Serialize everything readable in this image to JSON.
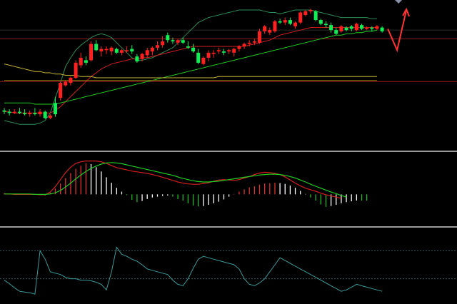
{
  "chart_data": [
    {
      "type": "candlestick",
      "panel": "price",
      "ylim": [
        0,
        100
      ],
      "candles": [
        {
          "o": 20,
          "h": 22,
          "l": 17,
          "c": 19
        },
        {
          "o": 19,
          "h": 21,
          "l": 16,
          "c": 18
        },
        {
          "o": 18,
          "h": 21,
          "l": 17,
          "c": 19
        },
        {
          "o": 19,
          "h": 22,
          "l": 17,
          "c": 18
        },
        {
          "o": 18,
          "h": 21,
          "l": 16,
          "c": 17
        },
        {
          "o": 17,
          "h": 20,
          "l": 15,
          "c": 18
        },
        {
          "o": 18,
          "h": 22,
          "l": 16,
          "c": 17
        },
        {
          "o": 17,
          "h": 21,
          "l": 15,
          "c": 19
        },
        {
          "o": 19,
          "h": 20,
          "l": 13,
          "c": 14
        },
        {
          "o": 14,
          "h": 17,
          "l": 13,
          "c": 16
        },
        {
          "o": 26,
          "h": 31,
          "l": 15,
          "c": 17
        },
        {
          "o": 30,
          "h": 43,
          "l": 28,
          "c": 42
        },
        {
          "o": 40,
          "h": 44,
          "l": 39,
          "c": 43
        },
        {
          "o": 42,
          "h": 47,
          "l": 40,
          "c": 46
        },
        {
          "o": 46,
          "h": 60,
          "l": 45,
          "c": 58
        },
        {
          "o": 56,
          "h": 66,
          "l": 54,
          "c": 62
        },
        {
          "o": 60,
          "h": 63,
          "l": 56,
          "c": 58
        },
        {
          "o": 60,
          "h": 75,
          "l": 59,
          "c": 73
        },
        {
          "o": 73,
          "h": 76,
          "l": 67,
          "c": 68
        },
        {
          "o": 67,
          "h": 71,
          "l": 63,
          "c": 69
        },
        {
          "o": 68,
          "h": 71,
          "l": 65,
          "c": 69
        },
        {
          "o": 67,
          "h": 71,
          "l": 64,
          "c": 70
        },
        {
          "o": 69,
          "h": 70,
          "l": 65,
          "c": 66
        },
        {
          "o": 66,
          "h": 69,
          "l": 64,
          "c": 68
        },
        {
          "o": 68,
          "h": 71,
          "l": 66,
          "c": 68
        },
        {
          "o": 69,
          "h": 72,
          "l": 65,
          "c": 67
        },
        {
          "o": 63,
          "h": 65,
          "l": 58,
          "c": 59
        },
        {
          "o": 61,
          "h": 66,
          "l": 59,
          "c": 65
        },
        {
          "o": 64,
          "h": 70,
          "l": 62,
          "c": 68
        },
        {
          "o": 67,
          "h": 71,
          "l": 64,
          "c": 70
        },
        {
          "o": 70,
          "h": 75,
          "l": 68,
          "c": 72
        },
        {
          "o": 72,
          "h": 79,
          "l": 70,
          "c": 75
        },
        {
          "o": 80,
          "h": 82,
          "l": 74,
          "c": 76
        },
        {
          "o": 76,
          "h": 78,
          "l": 73,
          "c": 75
        },
        {
          "o": 74,
          "h": 77,
          "l": 72,
          "c": 76
        },
        {
          "o": 76,
          "h": 78,
          "l": 73,
          "c": 74
        },
        {
          "o": 71,
          "h": 75,
          "l": 69,
          "c": 70
        },
        {
          "o": 70,
          "h": 73,
          "l": 66,
          "c": 67
        },
        {
          "o": 66,
          "h": 69,
          "l": 57,
          "c": 58
        },
        {
          "o": 57,
          "h": 63,
          "l": 56,
          "c": 62
        },
        {
          "o": 62,
          "h": 68,
          "l": 59,
          "c": 66
        },
        {
          "o": 65,
          "h": 68,
          "l": 62,
          "c": 66
        },
        {
          "o": 67,
          "h": 70,
          "l": 65,
          "c": 68
        },
        {
          "o": 67,
          "h": 69,
          "l": 64,
          "c": 66
        },
        {
          "o": 67,
          "h": 69,
          "l": 65,
          "c": 68
        },
        {
          "o": 66,
          "h": 70,
          "l": 63,
          "c": 69
        },
        {
          "o": 69,
          "h": 72,
          "l": 67,
          "c": 71
        },
        {
          "o": 71,
          "h": 74,
          "l": 69,
          "c": 73
        },
        {
          "o": 73,
          "h": 76,
          "l": 71,
          "c": 74
        },
        {
          "o": 74,
          "h": 77,
          "l": 72,
          "c": 75
        },
        {
          "o": 74,
          "h": 85,
          "l": 73,
          "c": 83
        },
        {
          "o": 83,
          "h": 88,
          "l": 81,
          "c": 87
        },
        {
          "o": 82,
          "h": 86,
          "l": 80,
          "c": 84
        },
        {
          "o": 83,
          "h": 92,
          "l": 82,
          "c": 91
        },
        {
          "o": 91,
          "h": 93,
          "l": 89,
          "c": 90
        },
        {
          "o": 90,
          "h": 94,
          "l": 88,
          "c": 92
        },
        {
          "o": 92,
          "h": 94,
          "l": 88,
          "c": 89
        },
        {
          "o": 87,
          "h": 91,
          "l": 85,
          "c": 90
        },
        {
          "o": 90,
          "h": 99,
          "l": 89,
          "c": 98
        },
        {
          "o": 96,
          "h": 100,
          "l": 95,
          "c": 99
        },
        {
          "o": 99,
          "h": 101,
          "l": 97,
          "c": 100
        },
        {
          "o": 99,
          "h": 100,
          "l": 91,
          "c": 92
        },
        {
          "o": 92,
          "h": 93,
          "l": 88,
          "c": 89
        },
        {
          "o": 89,
          "h": 91,
          "l": 86,
          "c": 88
        },
        {
          "o": 88,
          "h": 90,
          "l": 82,
          "c": 84
        },
        {
          "o": 84,
          "h": 86,
          "l": 80,
          "c": 81
        },
        {
          "o": 83,
          "h": 88,
          "l": 82,
          "c": 87
        },
        {
          "o": 86,
          "h": 87,
          "l": 83,
          "c": 84
        },
        {
          "o": 87,
          "h": 88,
          "l": 83,
          "c": 85
        },
        {
          "o": 84,
          "h": 90,
          "l": 83,
          "c": 89
        },
        {
          "o": 88,
          "h": 89,
          "l": 84,
          "c": 85
        },
        {
          "o": 85,
          "h": 87,
          "l": 84,
          "c": 86
        },
        {
          "o": 86,
          "h": 87,
          "l": 83,
          "c": 85
        },
        {
          "o": 85,
          "h": 88,
          "l": 84,
          "c": 87
        },
        {
          "o": 86,
          "h": 87,
          "l": 82,
          "c": 83
        }
      ],
      "overlays": [
        {
          "name": "",
          "color": "#2e8b57",
          "values": [
            12,
            11,
            10,
            9,
            9,
            9,
            9,
            10,
            12,
            18,
            30,
            42,
            55,
            62,
            68,
            72,
            75,
            78,
            80,
            81,
            80,
            78,
            74,
            70,
            66,
            62,
            60,
            60,
            61,
            62,
            64,
            66,
            68,
            70,
            74,
            78,
            82,
            86,
            90,
            92,
            94,
            95,
            96,
            97,
            98,
            99,
            100,
            100,
            100,
            100,
            100,
            99,
            98,
            98,
            97,
            98,
            99,
            100,
            100,
            100,
            100,
            99,
            98,
            97,
            96,
            95,
            94,
            94,
            94,
            94,
            94,
            94,
            93,
            93
          ]
        },
        {
          "name": "",
          "color": "#d21e1e",
          "values": [
            19,
            19,
            18,
            18,
            18,
            18,
            18,
            18,
            18,
            18,
            20,
            23,
            27,
            31,
            35,
            39,
            43,
            47,
            50,
            53,
            55,
            57,
            58,
            59,
            60,
            61,
            61,
            62,
            62,
            63,
            64,
            65,
            66,
            67,
            68,
            69,
            70,
            71,
            71,
            71,
            71,
            71,
            71,
            71,
            71,
            71,
            71,
            71,
            72,
            73,
            74,
            75,
            76,
            78,
            80,
            81,
            82,
            83,
            84,
            85,
            86,
            86,
            86,
            86,
            86,
            86,
            86,
            86,
            86,
            86,
            86,
            86,
            86,
            86
          ]
        },
        {
          "name": "",
          "color": "#22cc22",
          "values": [
            26,
            26,
            26,
            26,
            26,
            26,
            25,
            25,
            25,
            25,
            25,
            26,
            27,
            28,
            29,
            30,
            31,
            32,
            33,
            34,
            35,
            36,
            37,
            38,
            39,
            40,
            41,
            42,
            43,
            44,
            45,
            46,
            47,
            48,
            49,
            50,
            51,
            52,
            53,
            54,
            55,
            56,
            57,
            58,
            59,
            60,
            61,
            62,
            63,
            64,
            65,
            66,
            67,
            68,
            69,
            70,
            71,
            72,
            73,
            74,
            75,
            76,
            77,
            78,
            79,
            80,
            80,
            81,
            81,
            82,
            82,
            83,
            83,
            84
          ]
        },
        {
          "name": "",
          "color": "#c8b432",
          "values": [
            57,
            56,
            55,
            54,
            53,
            52,
            51,
            51,
            50,
            50,
            49,
            49,
            48,
            48,
            48,
            47,
            47,
            47,
            46,
            46,
            46,
            46,
            46,
            46,
            46,
            46,
            46,
            46,
            46,
            46,
            46,
            46,
            46,
            46,
            46,
            46,
            46,
            46,
            46,
            46,
            46,
            46,
            47,
            47,
            47,
            47,
            47,
            47,
            47,
            47,
            47,
            47,
            47,
            47,
            47,
            47,
            47,
            47,
            47,
            47,
            47,
            47,
            47,
            47,
            47,
            47,
            47,
            47,
            47,
            47,
            47,
            47,
            47,
            47
          ]
        },
        {
          "name": "",
          "color": "#8a7a10",
          "values": [
            44,
            44,
            44,
            44,
            44,
            44,
            44,
            44,
            44,
            44,
            44,
            44,
            44,
            44,
            44,
            44,
            44,
            44,
            44,
            44,
            44,
            44,
            44,
            44,
            44,
            44,
            44,
            44,
            44,
            44,
            44,
            44,
            44,
            44,
            44,
            44,
            44,
            44,
            44,
            44,
            44,
            44,
            44,
            44,
            44,
            44,
            44,
            44,
            44,
            44,
            44,
            44,
            44,
            44,
            44,
            44,
            44,
            44,
            44,
            44,
            44,
            44,
            44,
            44,
            44,
            44,
            44,
            44,
            44,
            44,
            44,
            44,
            44,
            44
          ]
        }
      ],
      "hlines": [
        {
          "y": 77,
          "color": "#8a1a1a"
        },
        {
          "y": 84,
          "color": "#2a2a2a"
        },
        {
          "y": 43,
          "color": "#8a1a1a"
        }
      ],
      "projection": {
        "color": "#ff3333",
        "points": [
          [
            0,
            85
          ],
          [
            1,
            68
          ],
          [
            2,
            100
          ]
        ]
      },
      "marker": {
        "color": "#8a8fa6",
        "y": 100
      }
    },
    {
      "type": "bar",
      "panel": "macd",
      "ylim": [
        -6,
        10
      ],
      "hist": [
        0.3,
        0.1,
        0.1,
        0.1,
        0.1,
        0.1,
        0.1,
        0.1,
        -0.3,
        0.4,
        1.5,
        2.8,
        4.2,
        5.5,
        6.6,
        7.4,
        8.0,
        7.8,
        7.0,
        5.9,
        4.4,
        3.0,
        1.7,
        0.7,
        -0.2,
        -1.4,
        -2.0,
        -1.7,
        -1.2,
        -0.8,
        -0.6,
        -0.4,
        -0.3,
        -0.6,
        -1.2,
        -1.6,
        -2.3,
        -2.9,
        -3.1,
        -3.0,
        -2.7,
        -2.3,
        -1.9,
        -1.3,
        -0.6,
        0.1,
        0.7,
        1.3,
        1.8,
        2.1,
        2.5,
        2.8,
        2.9,
        3.0,
        2.9,
        2.7,
        2.3,
        1.7,
        0.9,
        0.1,
        -0.8,
        -1.6,
        -2.6,
        -3.2,
        -3.0,
        -2.7,
        -2.3,
        -2.0,
        -1.8,
        -1.6,
        -1.6,
        -1.6
      ],
      "dif": [
        0.1,
        0.1,
        0.0,
        0.0,
        0.0,
        0.0,
        0.0,
        -0.1,
        -0.1,
        0.6,
        2.0,
        3.8,
        5.6,
        7.0,
        8.0,
        8.4,
        8.6,
        8.6,
        8.6,
        8.4,
        8.0,
        7.4,
        6.9,
        6.6,
        6.3,
        6.0,
        5.8,
        5.6,
        5.4,
        5.1,
        4.8,
        4.4,
        4.0,
        3.6,
        3.2,
        2.9,
        2.7,
        2.6,
        2.6,
        2.8,
        3.0,
        3.4,
        3.7,
        3.8,
        3.7,
        3.6,
        3.8,
        4.2,
        4.6,
        5.1,
        5.5,
        5.7,
        5.6,
        5.4,
        5.1,
        4.5,
        3.7,
        2.9,
        2.2,
        1.6,
        1.2,
        0.8,
        0.3,
        -0.1,
        -0.4,
        -0.7,
        -1.0
      ],
      "dea": [
        0.1,
        0.1,
        0.1,
        0.1,
        0.1,
        0.1,
        0.0,
        0.0,
        0.0,
        0.1,
        0.4,
        1.0,
        1.9,
        2.9,
        4.0,
        5.0,
        5.9,
        6.7,
        7.3,
        7.8,
        8.1,
        8.2,
        8.1,
        7.9,
        7.6,
        7.3,
        7.0,
        6.7,
        6.4,
        6.1,
        5.8,
        5.5,
        5.2,
        4.9,
        4.5,
        4.1,
        3.8,
        3.5,
        3.3,
        3.2,
        3.2,
        3.3,
        3.4,
        3.6,
        3.8,
        4.0,
        4.2,
        4.4,
        4.6,
        4.8,
        5.0,
        5.1,
        5.2,
        5.2,
        5.1,
        4.9,
        4.6,
        4.2,
        3.7,
        3.2,
        2.6,
        2.1,
        1.6,
        1.1,
        0.6,
        0.2,
        -0.3,
        -0.7
      ],
      "series_colors": {
        "up": "#e03030",
        "down": "#22bb22",
        "dif": "#dddddd",
        "dea": "#e8e000",
        "line_red": "#d21e1e",
        "line_green": "#22cc22",
        "hist_white": "#ffffff"
      }
    },
    {
      "type": "line",
      "panel": "oscillator",
      "ylim": [
        0,
        100
      ],
      "values": [
        28,
        23,
        17,
        12,
        11,
        10,
        8,
        70,
        58,
        40,
        38,
        36,
        32,
        30,
        30,
        28,
        28,
        27,
        25,
        22,
        14,
        40,
        75,
        65,
        62,
        58,
        55,
        50,
        44,
        42,
        40,
        38,
        36,
        28,
        22,
        20,
        30,
        45,
        58,
        62,
        60,
        58,
        56,
        54,
        52,
        50,
        44,
        30,
        22,
        20,
        24,
        30,
        40,
        50,
        60,
        56,
        52,
        48,
        44,
        40,
        36,
        32,
        28,
        24,
        20,
        16,
        12,
        14,
        18,
        22,
        20,
        18,
        16,
        14,
        12
      ],
      "levels": [
        70,
        30
      ],
      "color": "#3a9a9a",
      "level_color": "#3a5a5a"
    }
  ],
  "colors": {
    "background": "#000000",
    "bull_candle": "#ff2020",
    "bear_candle": "#11ee55",
    "panel_divider": "#9a9a9a"
  }
}
